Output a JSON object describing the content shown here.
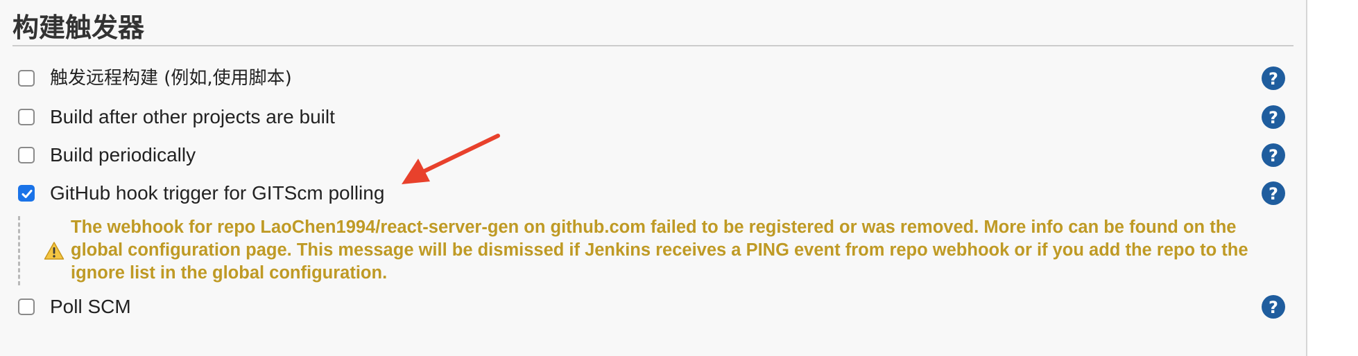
{
  "section": {
    "title": "构建触发器"
  },
  "triggers": [
    {
      "label": "触发远程构建 (例如,使用脚本)",
      "checked": false,
      "help_icon": "help-icon"
    },
    {
      "label": "Build after other projects are built",
      "checked": false,
      "help_icon": "help-icon"
    },
    {
      "label": "Build periodically",
      "checked": false,
      "help_icon": "help-icon"
    },
    {
      "label": "GitHub hook trigger for GITScm polling",
      "checked": true,
      "help_icon": "help-icon"
    },
    {
      "label": "Poll SCM",
      "checked": false,
      "help_icon": "help-icon"
    }
  ],
  "warning": {
    "icon": "warning-triangle-icon",
    "message": "The webhook for repo LaoChen1994/react-server-gen on github.com failed to be registered or was removed. More info can be found on the global configuration page. This message will be dismissed if Jenkins receives a PING event from repo webhook or if you add the repo to the ignore list in the global configuration."
  },
  "colors": {
    "warning_text": "#bf9a25",
    "help_icon": "#1f5d9e",
    "checkbox_checked": "#1a73e8",
    "annotation_arrow": "#e8412c"
  }
}
